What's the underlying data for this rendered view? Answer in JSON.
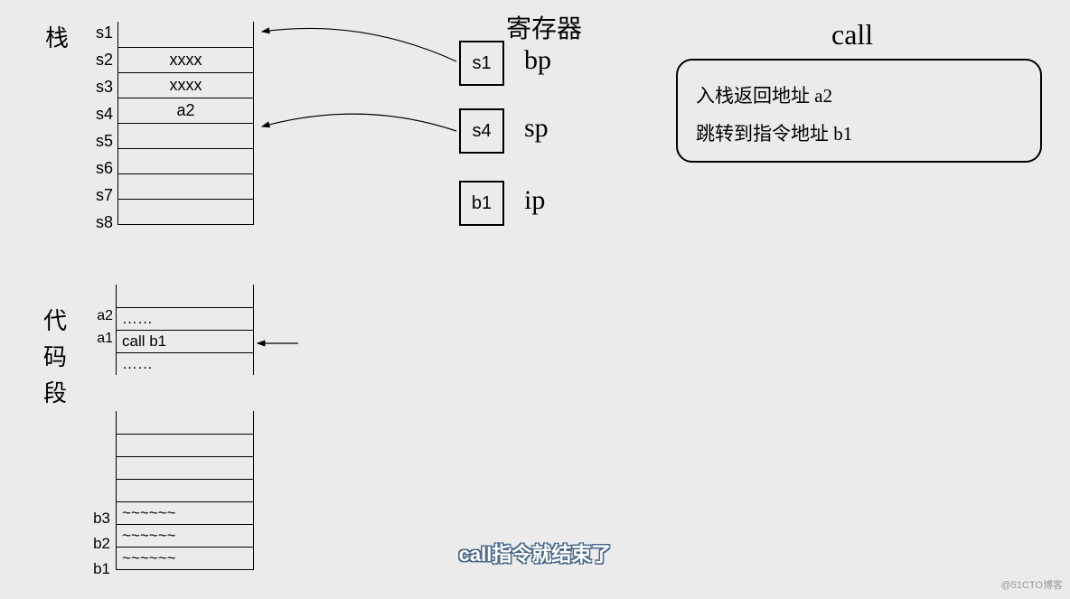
{
  "title_stack": "栈",
  "title_code": "代",
  "title_code2": "码",
  "title_code3": "段",
  "title_registers": "寄存器",
  "title_call": "call",
  "stack_labels": [
    "s1",
    "s2",
    "s3",
    "s4",
    "s5",
    "s6",
    "s7",
    "s8"
  ],
  "stack_cells": [
    "",
    "xxxx",
    "xxxx",
    "a2",
    "",
    "",
    "",
    ""
  ],
  "code1_labels": [
    "",
    "a2",
    "a1",
    ""
  ],
  "code1_cells": [
    "",
    "……",
    "call b1",
    "……"
  ],
  "code2_labels": [
    "",
    "",
    "",
    "",
    "b3",
    "b2",
    "b1"
  ],
  "code2_cells": [
    "",
    "",
    "",
    "",
    "~~~~~~",
    "~~~~~~",
    "~~~~~~"
  ],
  "registers": [
    {
      "val": "s1",
      "name": "bp"
    },
    {
      "val": "s4",
      "name": "sp"
    },
    {
      "val": "b1",
      "name": "ip"
    }
  ],
  "call_lines": [
    "入栈返回地址 a2",
    "跳转到指令地址 b1"
  ],
  "subtitle": "call指令就结束了",
  "watermark": "@51CTO博客"
}
